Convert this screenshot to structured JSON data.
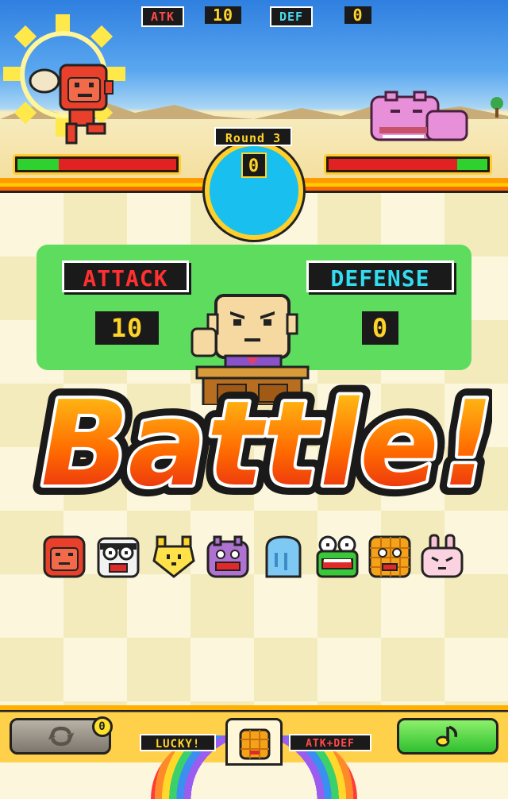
{
  "hud": {
    "atk_label": "ATK",
    "atk_value": "10",
    "def_label": "DEF",
    "def_value": "0"
  },
  "round": {
    "label": "Round 3",
    "counter": "0"
  },
  "health": {
    "left_fraction": 0.26,
    "right_fraction": 0.19
  },
  "panel": {
    "attack_label": "ATTACK",
    "attack_value": "10",
    "defense_label": "DEFENSE",
    "defense_value": "0"
  },
  "title": "Battle!",
  "fighters": [
    "red-monkey",
    "glasses-face",
    "yellow-bird",
    "purple-hippo",
    "blue-ghost",
    "green-frog",
    "orange-waffle",
    "pink-bunny"
  ],
  "bottom": {
    "lucky_label": "LUCKY!",
    "atkdef_label": "ATK+DEF",
    "swap_badge": "0"
  },
  "icons": {
    "swap": "swap-icon",
    "music": "music-note-icon",
    "card": "waffle-card-icon"
  },
  "colors": {
    "attack": "#ff3030",
    "defense": "#33dcf0",
    "panel": "#5edc5e",
    "hp_full": "#2fd12f",
    "hp_empty": "#e02222",
    "accent": "#ffd42a"
  }
}
